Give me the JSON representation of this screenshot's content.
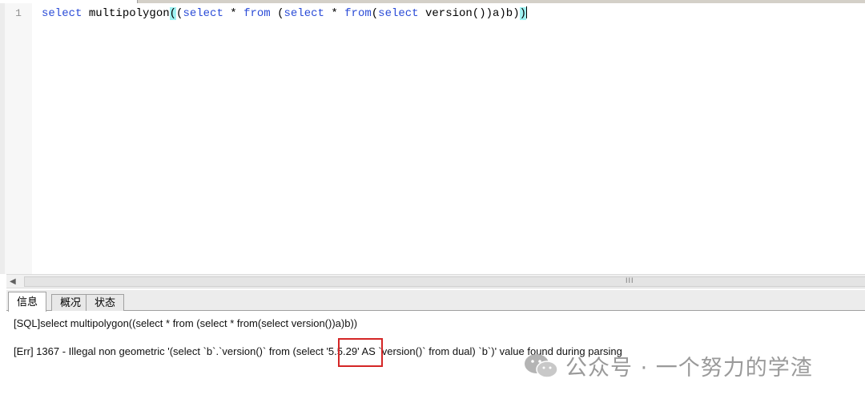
{
  "editor": {
    "line_number": "1",
    "code": {
      "t1": "select",
      "t2": " multipolygon",
      "t3": "(",
      "t4": "(",
      "t5": "select",
      "t6": " * ",
      "t7": "from",
      "t8": " (",
      "t9": "select",
      "t10": " * ",
      "t11": "from",
      "t12": "(",
      "t13": "select",
      "t14": " version())a)b)",
      "t15": ")"
    }
  },
  "tabs": [
    {
      "label": "信息",
      "active": true
    },
    {
      "label": "概况",
      "active": false
    },
    {
      "label": "状态",
      "active": false
    }
  ],
  "messages": {
    "sql": "[SQL]select multipolygon((select * from (select * from(select version())a)b))",
    "err": "[Err] 1367 - Illegal non geometric '(select `b`.`version()` from (select '5.5.29' AS `version()` from dual) `b`)' value found during parsing"
  },
  "scrollbar": {
    "grip": "III"
  },
  "watermark": {
    "text": "公众号 · 一个努力的学渣"
  },
  "colors": {
    "keyword": "#2a4bd7",
    "highlight_box": "#d42626",
    "bracket_match": "#9ff3f3"
  }
}
